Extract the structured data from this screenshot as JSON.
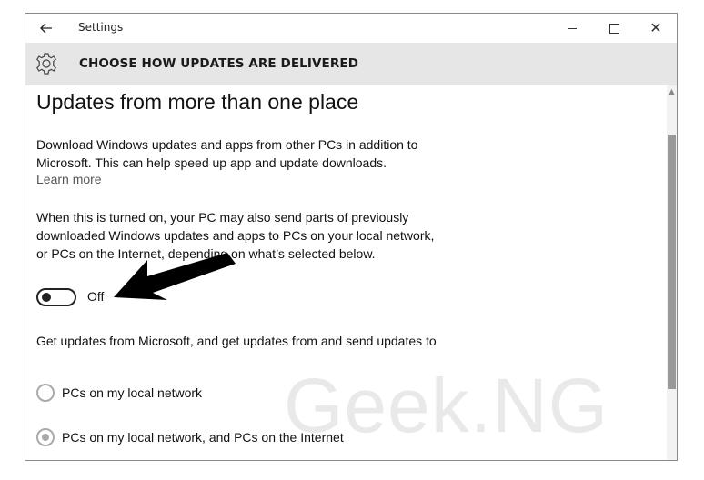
{
  "window": {
    "title": "Settings",
    "back_icon": "arrow-left-icon",
    "controls": [
      "minimize-icon",
      "maximize-icon",
      "close-icon"
    ],
    "close_glyph": "✕"
  },
  "header": {
    "icon": "gear-icon",
    "title": "CHOOSE HOW UPDATES ARE DELIVERED"
  },
  "main": {
    "page_title": "Updates from more than one place",
    "intro": "Download Windows updates and apps from other PCs in addition to Microsoft. This can help speed up app and update downloads.",
    "learn_more": "Learn more",
    "description": "When this is turned on, your PC may also send parts of previously downloaded Windows updates and apps to PCs on your local network, or PCs on the Internet, depending on what’s selected below.",
    "toggle": {
      "state": "Off",
      "on": false
    },
    "options_label": "Get updates from Microsoft, and get updates from and send updates to",
    "options": [
      {
        "label": "PCs on my local network",
        "selected": false
      },
      {
        "label": "PCs on my local network, and PCs on the Internet",
        "selected": true
      }
    ]
  },
  "watermark": "Geek.NG",
  "annotation": {
    "type": "arrow",
    "color": "#000000",
    "points_to": "toggle"
  },
  "colors": {
    "header_bg": "#e6e6e6",
    "scroll_thumb": "#999999",
    "disabled_radio": "#aaaaaa"
  }
}
